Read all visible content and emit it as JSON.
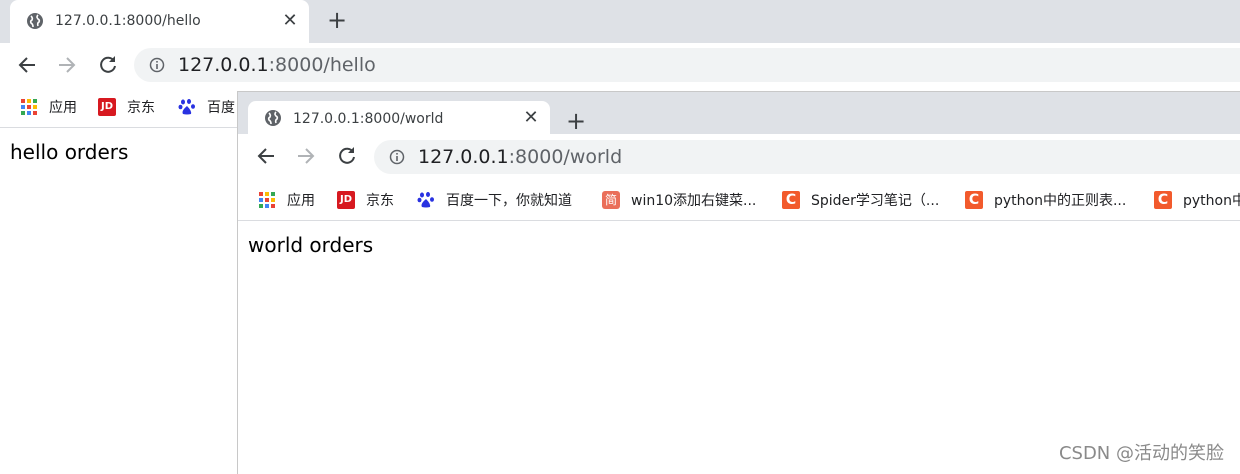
{
  "back_window": {
    "tab_title": "127.0.0.1:8000/hello",
    "url_host": "127.0.0.1",
    "url_path": ":8000/hello",
    "bookmarks": [
      {
        "label": "应用",
        "icon": "apps-icon"
      },
      {
        "label": "京东",
        "icon": "jd-icon",
        "glyph": "JD"
      },
      {
        "label": "百度",
        "icon": "baidu-paw-icon"
      }
    ],
    "page_text": "hello orders"
  },
  "front_window": {
    "tab_title": "127.0.0.1:8000/world",
    "url_host": "127.0.0.1",
    "url_path": ":8000/world",
    "bookmarks": [
      {
        "label": "应用",
        "icon": "apps-icon"
      },
      {
        "label": "京东",
        "icon": "jd-icon",
        "glyph": "JD"
      },
      {
        "label": "百度一下，你就知道",
        "icon": "baidu-paw-icon"
      },
      {
        "label": "win10添加右键菜...",
        "icon": "jianshu-icon",
        "glyph": "简"
      },
      {
        "label": "Spider学习笔记（...",
        "icon": "csdn-c-icon",
        "glyph": "C"
      },
      {
        "label": "python中的正则表...",
        "icon": "csdn-c-icon",
        "glyph": "C"
      },
      {
        "label": "python中",
        "icon": "csdn-c-icon",
        "glyph": "C"
      }
    ],
    "page_text": "world orders"
  },
  "watermark": "CSDN @活动的笑脸",
  "colors": {
    "tabstrip": "#dee1e6",
    "omnibox": "#f1f3f4",
    "csdn_orange": "#f25a2c",
    "jd_red": "#d71920"
  }
}
